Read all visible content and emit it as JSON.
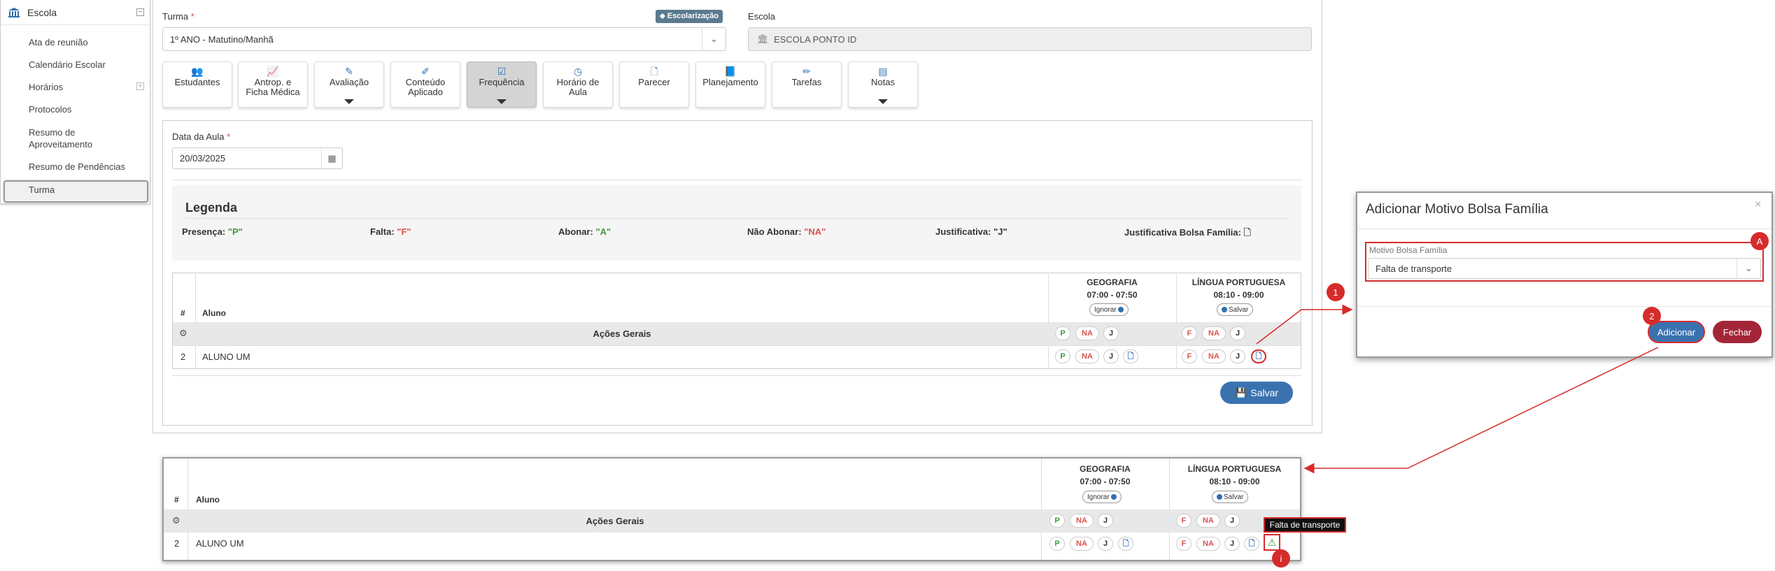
{
  "sidebar": {
    "title": "Escola",
    "items": [
      "Ata de reunião",
      "Calendário Escolar",
      "Horários",
      "Protocolos",
      "Resumo de Aproveitamento",
      "Resumo de Pendências",
      "Turma"
    ]
  },
  "form": {
    "turma_label": "Turma",
    "turma_value": "1º ANO - Matutino/Manhã",
    "escola_label": "Escola",
    "escola_value": "ESCOLA PONTO ID",
    "badge": "Escolarização",
    "required_mark": "*"
  },
  "tabs": [
    {
      "label": "Estudantes",
      "icon": "users-icon",
      "glyph": "👥"
    },
    {
      "label": "Antrop. e Ficha Médica",
      "icon": "chart-icon",
      "glyph": "📈"
    },
    {
      "label": "Avaliação",
      "icon": "edit-icon",
      "glyph": "✎"
    },
    {
      "label": "Conteúdo Aplicado",
      "icon": "wand-icon",
      "glyph": "✐"
    },
    {
      "label": "Frequência",
      "icon": "check-square-icon",
      "glyph": "☑"
    },
    {
      "label": "Horário de Aula",
      "icon": "clock-icon",
      "glyph": "◷"
    },
    {
      "label": "Parecer",
      "icon": "file-icon",
      "glyph": "🗋"
    },
    {
      "label": "Planejamento",
      "icon": "book-icon",
      "glyph": "📘"
    },
    {
      "label": "Tarefas",
      "icon": "pencil-icon",
      "glyph": "✏"
    },
    {
      "label": "Notas",
      "icon": "list-icon",
      "glyph": "▤"
    }
  ],
  "attendance": {
    "date_label": "Data da Aula",
    "date_value": "20/03/2025",
    "legend_title": "Legenda",
    "legend": {
      "presenca_label": "Presença:",
      "presenca_code": "\"P\"",
      "falta_label": "Falta:",
      "falta_code": "\"F\"",
      "abonar_label": "Abonar:",
      "abonar_code": "\"A\"",
      "nao_abonar_label": "Não Abonar:",
      "nao_abonar_code": "\"NA\"",
      "justificativa_label": "Justificativa:",
      "justificativa_code": "\"J\"",
      "bolsa_label": "Justificativa Bolsa Família:"
    },
    "table": {
      "col_num": "#",
      "col_aluno": "Aluno",
      "subject1": {
        "name": "GEOGRAFIA",
        "time": "07:00 - 07:50",
        "toggle": "Ignorar"
      },
      "subject2": {
        "name": "LÍNGUA PORTUGUESA",
        "time": "08:10 - 09:00",
        "toggle": "Salvar"
      },
      "acoes_gerais": "Ações Gerais",
      "row_num": "2",
      "row_name": "ALUNO UM",
      "codes": {
        "p": "P",
        "f": "F",
        "na": "NA",
        "j": "J"
      }
    },
    "save_label": "Salvar"
  },
  "modal": {
    "title": "Adicionar Motivo Bolsa Família",
    "close": "×",
    "field_label": "Motivo Bolsa Família",
    "field_value": "Falta de transporte",
    "add_label": "Adicionar",
    "close_label": "Fechar"
  },
  "annotations": {
    "m1": "1",
    "m2": "2",
    "mA": "A",
    "mi": "i"
  },
  "tooltip": "Falta de transporte",
  "colors": {
    "accent": "#3a72b0",
    "danger": "#d62b2b",
    "fechar": "#a32638",
    "present": "#3c9a3c"
  }
}
